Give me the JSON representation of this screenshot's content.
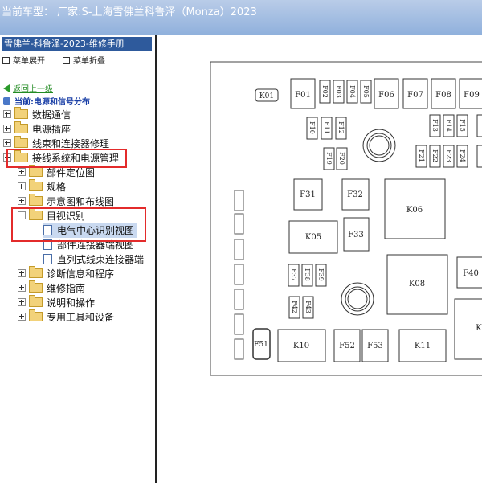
{
  "header": {
    "title": "当前车型：  厂家:S-上海雪佛兰科鲁泽（Monza）2023"
  },
  "sidebar": {
    "title": "雪佛兰-科鲁泽-2023-维修手册",
    "expand_label": "菜单展开",
    "collapse_label": "菜单折叠",
    "back_label": "返回上一级",
    "current_label": "当前:电源和信号分布",
    "items": [
      {
        "label": "数据通信"
      },
      {
        "label": "电源插座"
      },
      {
        "label": "线束和连接器修理"
      },
      {
        "label": "接线系统和电源管理"
      },
      {
        "label": "部件定位图"
      },
      {
        "label": "规格"
      },
      {
        "label": "示意图和布线图"
      },
      {
        "label": "目视识别"
      },
      {
        "label": "电气中心识别视图"
      },
      {
        "label": "部件连接器端视图"
      },
      {
        "label": "直列式线束连接器端"
      },
      {
        "label": "诊断信息和程序"
      },
      {
        "label": "维修指南"
      },
      {
        "label": "说明和操作"
      },
      {
        "label": "专用工具和设备"
      }
    ]
  },
  "diagram": {
    "labels": {
      "K01": "K01",
      "F01": "F01",
      "F02": "F02",
      "F03": "F03",
      "F04": "F04",
      "F05": "F05",
      "F06": "F06",
      "F07": "F07",
      "F08": "F08",
      "F09": "F09",
      "F10": "F10",
      "F11": "F11",
      "F12": "F12",
      "F13": "F13",
      "F14": "F14",
      "F15": "F15",
      "F19": "F19",
      "F20": "F20",
      "F21": "F21",
      "F22": "F22",
      "F23": "F23",
      "F24": "F24",
      "F31": "F31",
      "F32": "F32",
      "K06": "K06",
      "K05": "K05",
      "F33": "F33",
      "F37": "F37",
      "F38": "F38",
      "F39": "F39",
      "K08": "K08",
      "F40": "F40",
      "F42": "F42",
      "F43": "F43",
      "K_right": "K",
      "F51": "F51",
      "K10": "K10",
      "F52": "F52",
      "F53": "F53",
      "K11": "K11"
    }
  }
}
